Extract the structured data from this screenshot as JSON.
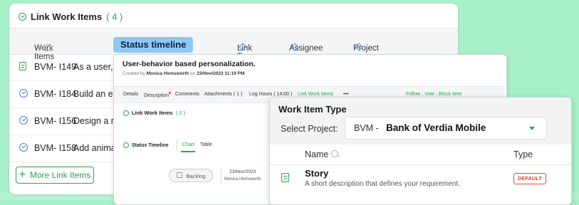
{
  "link_panel": {
    "title": "Link Work Items",
    "count": "( 4 )",
    "columns": {
      "work_items": "Work Items",
      "link_type": "Link Type",
      "assignee": "Assignee",
      "project": "Project"
    },
    "rows": [
      {
        "id": "BVM- I149",
        "title": "As a user, I",
        "icon": "story-icon"
      },
      {
        "id": "BVM- I184",
        "title": "Build an en",
        "icon": "task-icon"
      },
      {
        "id": "BVM- I156",
        "title": "Design a res",
        "icon": "task-icon"
      },
      {
        "id": "BVM- I158",
        "title": "Add animat",
        "icon": "task-icon"
      }
    ],
    "more_button": "More Link Items"
  },
  "tag_label": "Status timeline",
  "detail_panel": {
    "title": "User-behavior based personalization.",
    "created_prefix": "Created by",
    "created_by": "Monica Hemsworth",
    "created_on_prefix": "on",
    "created_on": "23/Nov/2023 11:19 PM",
    "tabs": [
      "Details",
      "Description",
      "Comments",
      "Attachments ( 1 )",
      "Log Hours ( 14:00 )",
      "Link Work Items",
      "•••"
    ],
    "actions": "Follow  ,  Vote  ,  Block Item",
    "link_title": "Link Work Items",
    "link_count": "( 0 )",
    "status_timeline": "Status Timeline",
    "chart_tab": "Chart",
    "table_tab": "Table",
    "status_pill": "Backlog",
    "status_date": "23/Nov/2023",
    "status_by": "Monica Hemsworth"
  },
  "type_panel": {
    "title": "Work Item Type",
    "select_label": "Select Project:",
    "project_prefix": "BVM -",
    "project_name": "Bank of Verdia Mobile",
    "col_name": "Name",
    "col_type": "Type",
    "row_name": "Story",
    "row_desc": "A short description that defines your requirement.",
    "row_badge": "DEFAULT"
  },
  "colors": {
    "accent": "#26a844",
    "background": "#a8f0c8",
    "tag": "#8fc8f2",
    "badge": "#e84a3a"
  }
}
